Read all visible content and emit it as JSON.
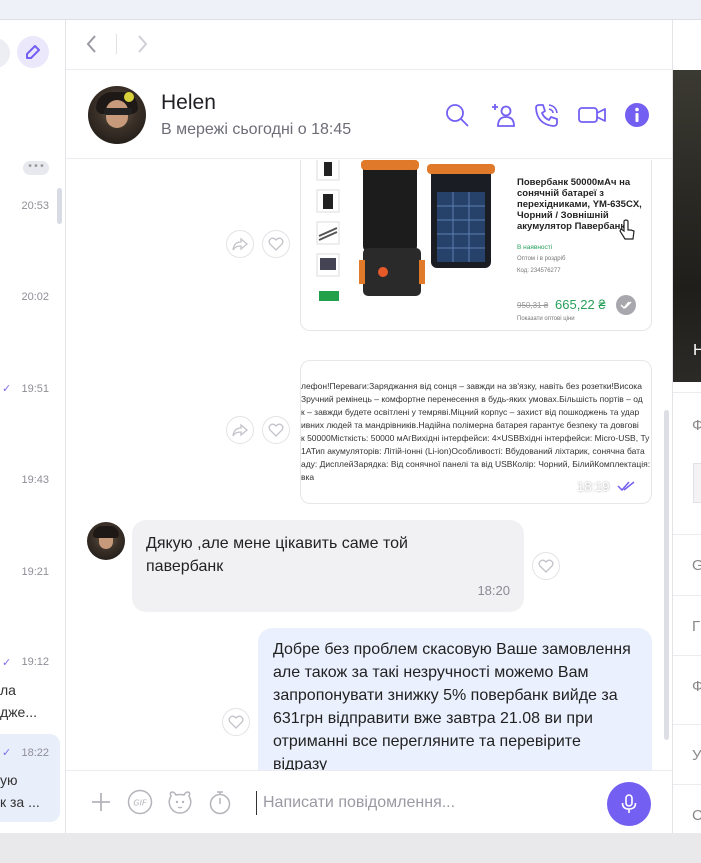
{
  "chat_list": {
    "times": [
      "20:53",
      "20:02",
      "19:51",
      "19:43",
      "19:21",
      "19:12",
      "18:22"
    ],
    "dots": "•••",
    "snippet_1": [
      "ла",
      "дже..."
    ],
    "snippet_2": [
      "ую",
      "к за ..."
    ]
  },
  "contact": {
    "name": "Helen",
    "status": "В мережі сьогодні о 18:45"
  },
  "product_card": {
    "title": "Повербанк 50000мАч на сонячній батареї з перехідниками, YM-635CX, Чорний / Зовнішній акумулятор Павербанк",
    "availability": "В наявності",
    "wholesale": "Оптом і в роздріб",
    "code": "Код: 234576277",
    "old_price": "950,31 ₴",
    "price": "665,22 ₴",
    "wholesale_link": "Показати оптові ціни"
  },
  "description_card": {
    "lines": [
      "лефон!Переваги:Заряджання від сонця – завжди на зв'язку, навіть без розетки!Висока",
      "Зручний ремінець – комфортне перенесення в будь-яких умовах.Більшість портів – од",
      "к – завжди будете освітлені у темряві.Міцний корпус – захист від пошкоджень та удар",
      "ивних людей та мандрівників.Надійна полімерна батарея гарантує безпеку та довгові",
      "к 50000Місткість: 50000 мАгВихідні інтерфейси: 4×USBВхідні інтерфейси: Micro-USB, Ту",
      "1АТип акумуляторів: Літій-іонні (Li-ion)Особливості: Вбудований ліхтарик, сонячна бата",
      "аду: ДисплейЗарядка: Від сонячної панелі та від USBКолір: Чорний, БілийКомплектація:",
      "вка"
    ],
    "time": "18:19"
  },
  "messages": {
    "incoming_text": "Дякую ,але мене цікавить саме той павербанк",
    "incoming_time": "18:20",
    "outgoing_text": "Добре без проблем скасовую Ваше замовлення але також за такі незручності можемо Вам запропонувати знижку 5% повербанк вийде за 631грн відправити вже завтра 21.08 ви при отриманні все перегляните та перевірите відразу"
  },
  "composer": {
    "placeholder": "Написати повідомлення..."
  },
  "info_panel": {
    "photo_letter": "Н",
    "letters": [
      "Ф",
      "G",
      "Г",
      "Ф",
      "У",
      "С"
    ]
  },
  "colors": {
    "accent": "#7360f2",
    "outgoing_bubble": "#eaf0fd",
    "incoming_bubble": "#f1f1f4"
  }
}
